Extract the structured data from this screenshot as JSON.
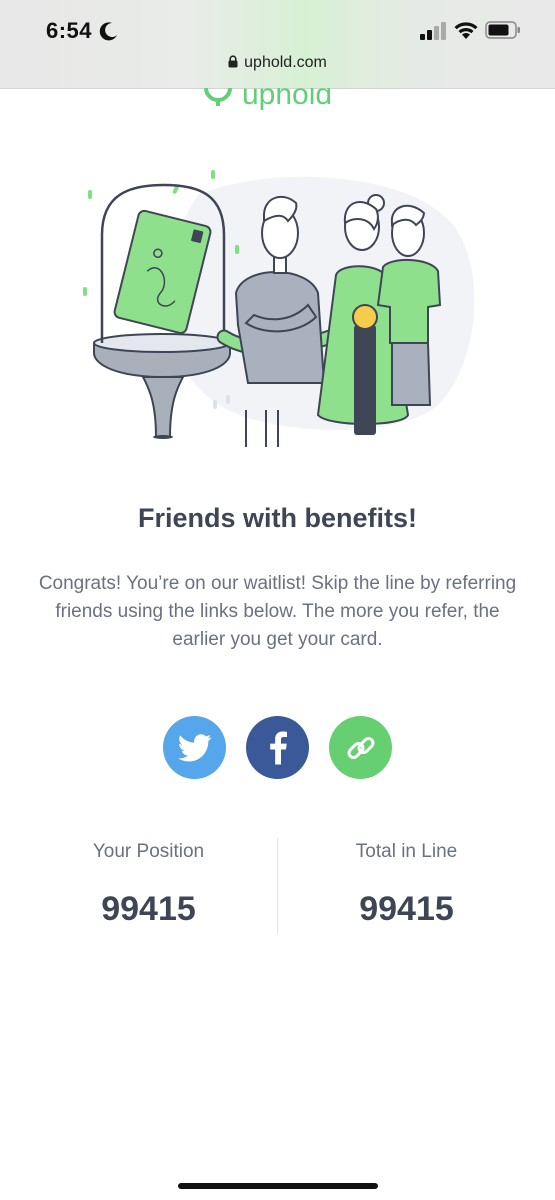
{
  "status_bar": {
    "time": "6:54",
    "url": "uphold.com",
    "icons": [
      "moon-icon",
      "cellular-signal-icon",
      "wifi-icon",
      "battery-icon",
      "lock-icon"
    ]
  },
  "brand": {
    "logo_text": "uphold",
    "accent_color": "#49cc68"
  },
  "main": {
    "headline": "Friends with benefits!",
    "intro": "Congrats! You’re on our waitlist! Skip the line by referring friends using the links below. The more you refer, the earlier you get your card."
  },
  "share": {
    "buttons": [
      {
        "network": "twitter",
        "icon": "twitter-icon",
        "color": "#55a6ea"
      },
      {
        "network": "facebook",
        "icon": "facebook-icon",
        "color": "#3b5998"
      },
      {
        "network": "copy-link",
        "icon": "link-icon",
        "color": "#66cf71"
      }
    ]
  },
  "stats": {
    "position_label": "Your Position",
    "position_value": "99415",
    "total_label": "Total in Line",
    "total_value": "99415"
  },
  "colors": {
    "heading": "#3e4656",
    "body_text": "#6a7180",
    "card_green": "#8fe08c"
  }
}
